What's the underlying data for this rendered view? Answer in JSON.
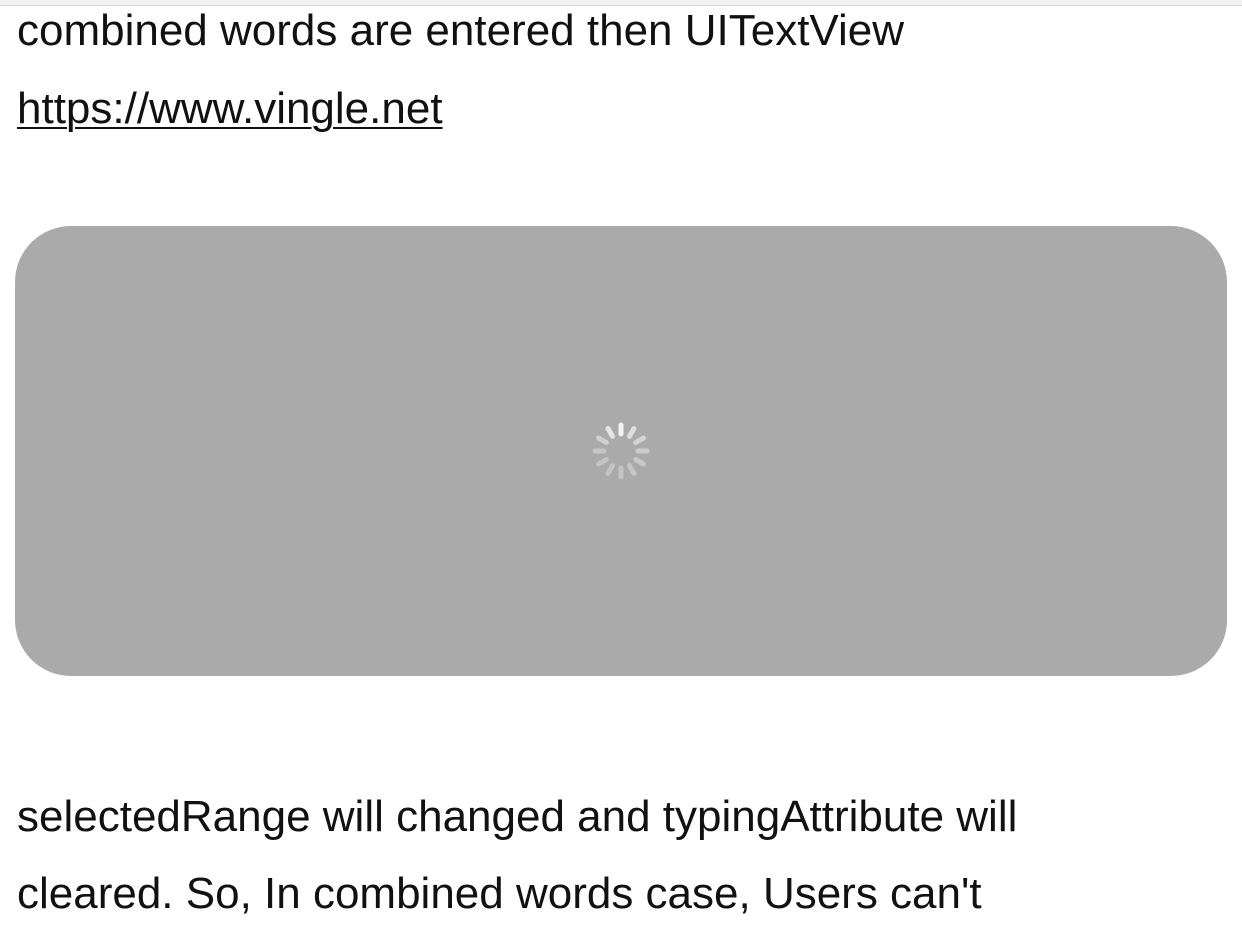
{
  "editor": {
    "line_top": "combined words are entered then UITextView",
    "link_text": "https://www.vingle.net",
    "line_bottom_1": "selectedRange will changed and typingAttribute will",
    "line_bottom_2": "cleared. So, In combined words case, Users can't"
  },
  "embed_preview": {
    "state": "loading",
    "background_color": "#aaaaaa",
    "spinner_icon": "activity-indicator-icon"
  }
}
